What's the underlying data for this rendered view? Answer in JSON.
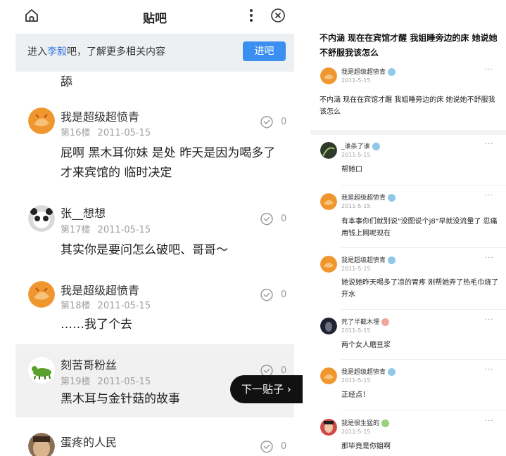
{
  "left": {
    "title": "贴吧",
    "banner": {
      "prefix": "进入",
      "link": "李毅",
      "suffix": "吧，了解更多相关内容",
      "button": "进吧"
    },
    "top_fragment": "舔",
    "posts": [
      {
        "user": "我是超级超愤青",
        "floor": "第16楼",
        "date": "2011-05-15",
        "likes": "0",
        "content": "屁啊   黑木耳你妹   是处   昨天是因为喝多了才来宾馆的   临时决定",
        "avatar": "orange-circle"
      },
      {
        "user": "张__想想",
        "floor": "第17楼",
        "date": "2011-05-15",
        "likes": "0",
        "content": "其实你是要问怎么破吧、哥哥～",
        "avatar": "panda"
      },
      {
        "user": "我是超级超愤青",
        "floor": "第18楼",
        "date": "2011-05-15",
        "likes": "0",
        "content": "……我了个去",
        "avatar": "orange-circle"
      },
      {
        "user": "刻苦哥粉丝",
        "floor": "第19楼",
        "date": "2011-05-15",
        "likes": "0",
        "content": "黑木耳与金针菇的故事",
        "avatar": "green-creature"
      },
      {
        "user": "蛋疼的人民",
        "floor": "",
        "date": "",
        "likes": "0",
        "content": "",
        "avatar": "face"
      }
    ],
    "next_button": "下一贴子 ›"
  },
  "right": {
    "title": "不内涵   现在在宾馆才醒   我姐睡旁边的床   她说她不舒服我该怎么",
    "op": {
      "user": "我是超级超愤青",
      "date": "2011-5-15",
      "content": "不内涵   现在在宾馆才醒   我姐睡旁边的床   她说她不舒服我该怎么"
    },
    "replies": [
      {
        "user": "_谁杀了谁",
        "date": "2011-5-15",
        "content": "帮她口",
        "badge": "blue",
        "avatar": "dark-figure"
      },
      {
        "user": "我是超级超愤青",
        "date": "2011-5-15",
        "content": "有本事你们就别说\"没图说个j8\"早就没流量了   忍痛用钱上网呢现在",
        "badge": "blue",
        "avatar": "orange-circle"
      },
      {
        "user": "我是超级超愤青",
        "date": "2011-5-15",
        "content": "她说她昨天喝多了凉的胃疼   刚帮她弄了热毛巾烧了开水",
        "badge": "blue",
        "avatar": "orange-circle"
      },
      {
        "user": "死了半截木埋",
        "date": "2011-5-15",
        "content": "两个女人磨豆浆",
        "badge": "orange",
        "avatar": "dark-portrait"
      },
      {
        "user": "我是超级超愤青",
        "date": "2011-5-15",
        "content": "正经点！",
        "badge": "blue",
        "avatar": "orange-circle"
      },
      {
        "user": "我是很生猛的",
        "date": "2011-5-15",
        "content": "那毕竟是你姐啊",
        "badge": "green",
        "avatar": "red-face"
      }
    ]
  },
  "colors": {
    "accent": "#3b8ff1",
    "link": "#3877e0",
    "meta_gray": "#a0a0a0",
    "badge_blue": "#8fc8e8"
  }
}
